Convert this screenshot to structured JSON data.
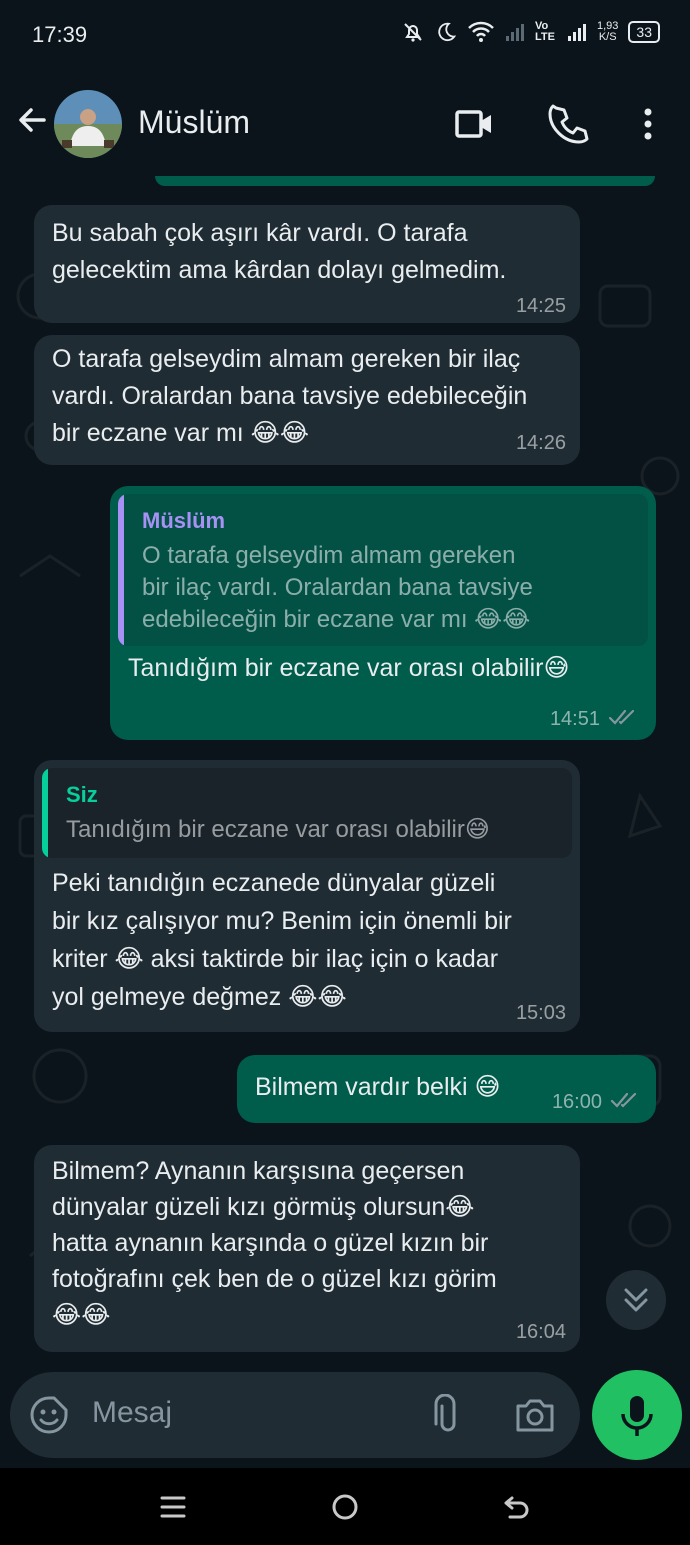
{
  "status_bar": {
    "time": "17:39",
    "net_speed_value": "1,93",
    "net_speed_unit": "K/S",
    "network_label": "Vo LTE",
    "battery": "33",
    "icons": [
      "mute-icon",
      "moon-icon",
      "wifi-icon",
      "signal-icon",
      "signal-icon",
      "battery-icon"
    ]
  },
  "header": {
    "contact_name": "Müslüm",
    "icons": [
      "back-arrow-icon",
      "video-call-icon",
      "voice-call-icon",
      "more-vertical-icon"
    ]
  },
  "messages": [
    {
      "direction": "incoming",
      "lines": [
        "Bu sabah çok aşırı kâr vardı. O tarafa",
        "gelecektim ama kârdan dolayı gelmedim."
      ],
      "time": "14:25"
    },
    {
      "direction": "incoming",
      "lines": [
        "O tarafa gelseydim almam gereken bir ilaç",
        "vardı. Oralardan bana tavsiye edebileceğin",
        "bir eczane var mı 😂😂"
      ],
      "time": "14:26"
    },
    {
      "direction": "outgoing",
      "quote": {
        "author": "Müslüm",
        "lines": [
          "O tarafa gelseydim almam gereken",
          "bir ilaç vardı. Oralardan bana tavsiye",
          "edebileceğin bir eczane var mı 😂😂"
        ]
      },
      "lines": [
        "Tanıdığım bir eczane var orası olabilir😅"
      ],
      "time": "14:51",
      "read": true
    },
    {
      "direction": "incoming",
      "quote": {
        "author": "Siz",
        "lines": [
          "Tanıdığım bir eczane var orası olabilir😅"
        ]
      },
      "lines": [
        "Peki tanıdığın eczanede dünyalar güzeli",
        "bir kız çalışıyor mu? Benim için önemli bir",
        "kriter 😂 aksi taktirde bir ilaç için o kadar",
        "yol gelmeye değmez 😂😂"
      ],
      "time": "15:03"
    },
    {
      "direction": "outgoing",
      "lines": [
        "Bilmem vardır belki 😅"
      ],
      "time": "16:00",
      "read": true
    },
    {
      "direction": "incoming",
      "lines": [
        "Bilmem? Aynanın karşısına geçersen",
        "dünyalar güzeli kızı görmüş olursun😂",
        "hatta aynanın karşında o güzel kızın bir",
        "fotoğrafını çek ben de o güzel kızı görim",
        "😂😂"
      ],
      "time": "16:04"
    }
  ],
  "composer": {
    "placeholder": "Mesaj",
    "icons": [
      "emoji-sticker-icon",
      "attach-icon",
      "camera-icon",
      "mic-icon"
    ]
  },
  "colors": {
    "background": "#0b141a",
    "incoming_bubble": "#202c33",
    "outgoing_bubble": "#005c4b",
    "quote_siz_bar": "#06cf9c",
    "quote_muslum_bar": "#a791f5",
    "mic_button": "#21c063",
    "read_ticks": "#8696a0"
  }
}
